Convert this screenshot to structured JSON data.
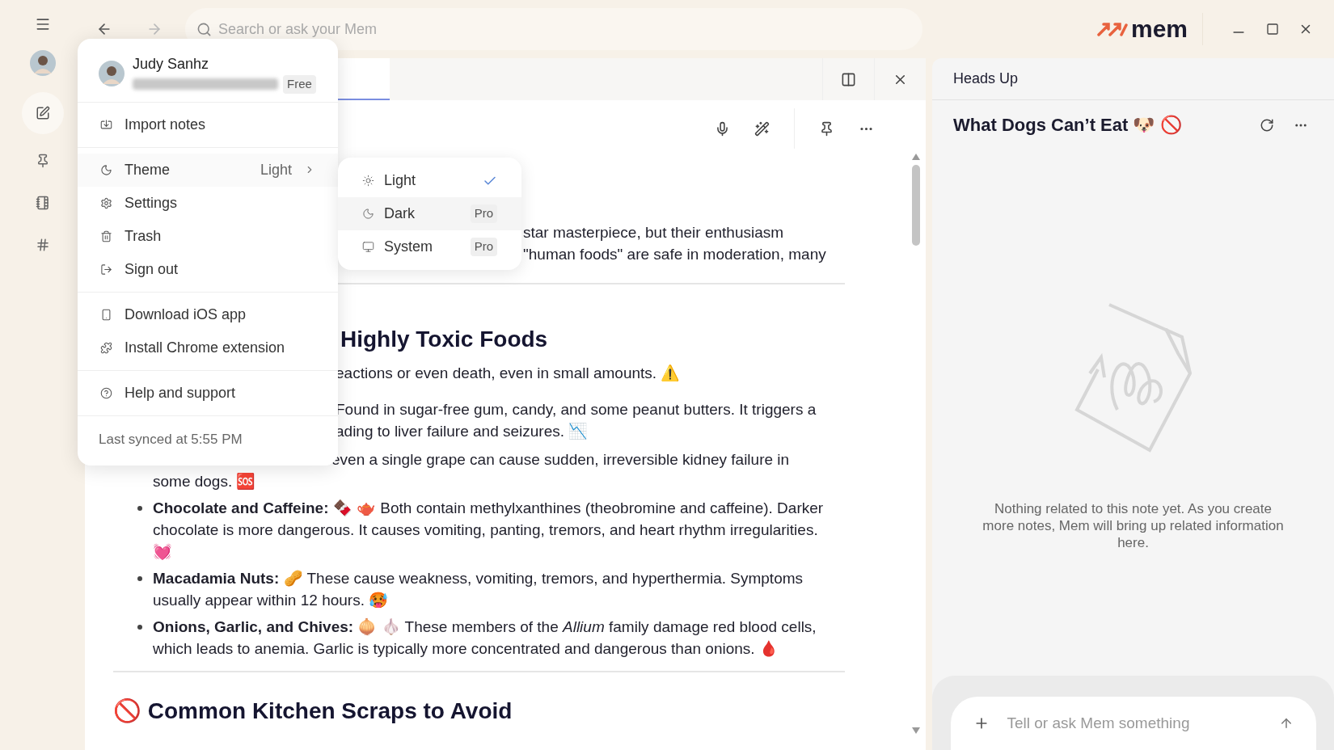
{
  "top_bar": {
    "search": {
      "placeholder": "Search or ask your Mem"
    },
    "logo": "mem"
  },
  "tab": {
    "selected": true
  },
  "note": {
    "intro_lines": [
      "star masterpiece, but their enthusiasm",
      "\"human foods\" are safe in moderation, many"
    ],
    "heading": "Highly Toxic Foods",
    "partial_line": "eactions or even death, even in small amounts. ⚠️",
    "xylitol_lines": [
      "Found in sugar-free gum, candy, and some peanut butters. It triggers a",
      "ading to liver failure and seizures. 📉"
    ],
    "grape_lines": [
      "even a single grape can cause sudden, irreversible kidney failure in",
      "some dogs. 🆘"
    ],
    "bullets": [
      "**Chocolate and Caffeine:** 🍫 🫖 Both contain methylxanthines (theobromine and caffeine). Darker chocolate is more dangerous. It causes vomiting, panting, tremors, and heart rhythm irregularities. 💓",
      "**Macadamia Nuts:** 🥜 These cause weakness, vomiting, tremors, and hyperthermia. Symptoms usually appear within 12 hours. 🥵",
      "**Onions, Garlic, and Chives:** 🧅 🧄 These members of the *Allium* family damage red blood cells, which leads to anemia. Garlic is typically more concentrated and dangerous than onions. 🩸"
    ],
    "next_heading": "🚫 Common Kitchen Scraps to Avoid"
  },
  "account_menu": {
    "name": "Judy Sanhz",
    "plan": "Free",
    "sections": [
      {
        "items": [
          {
            "label": "Import notes"
          }
        ]
      },
      {
        "items": [
          {
            "label": "Theme",
            "value": "Light",
            "expanded": true
          },
          {
            "label": "Settings"
          },
          {
            "label": "Trash"
          },
          {
            "label": "Sign out"
          }
        ]
      },
      {
        "items": [
          {
            "label": "Download iOS app"
          },
          {
            "label": "Install Chrome extension"
          }
        ]
      },
      {
        "items": [
          {
            "label": "Help and support"
          }
        ]
      }
    ],
    "footer": "Last synced at 5:55 PM"
  },
  "theme_menu": {
    "options": [
      {
        "label": "Light",
        "selected": true,
        "highlighted": false
      },
      {
        "label": "Dark",
        "badge": "Pro",
        "selected": false,
        "highlighted": true
      },
      {
        "label": "System",
        "badge": "Pro",
        "selected": false,
        "highlighted": false
      }
    ]
  },
  "heads_up": {
    "header": "Heads Up",
    "title": "What Dogs Can’t Eat 🐶 🚫",
    "empty_text": "Nothing related to this note yet. As you create more notes, Mem will bring up related information here.",
    "input": {
      "placeholder": "Tell or ask Mem something"
    }
  }
}
